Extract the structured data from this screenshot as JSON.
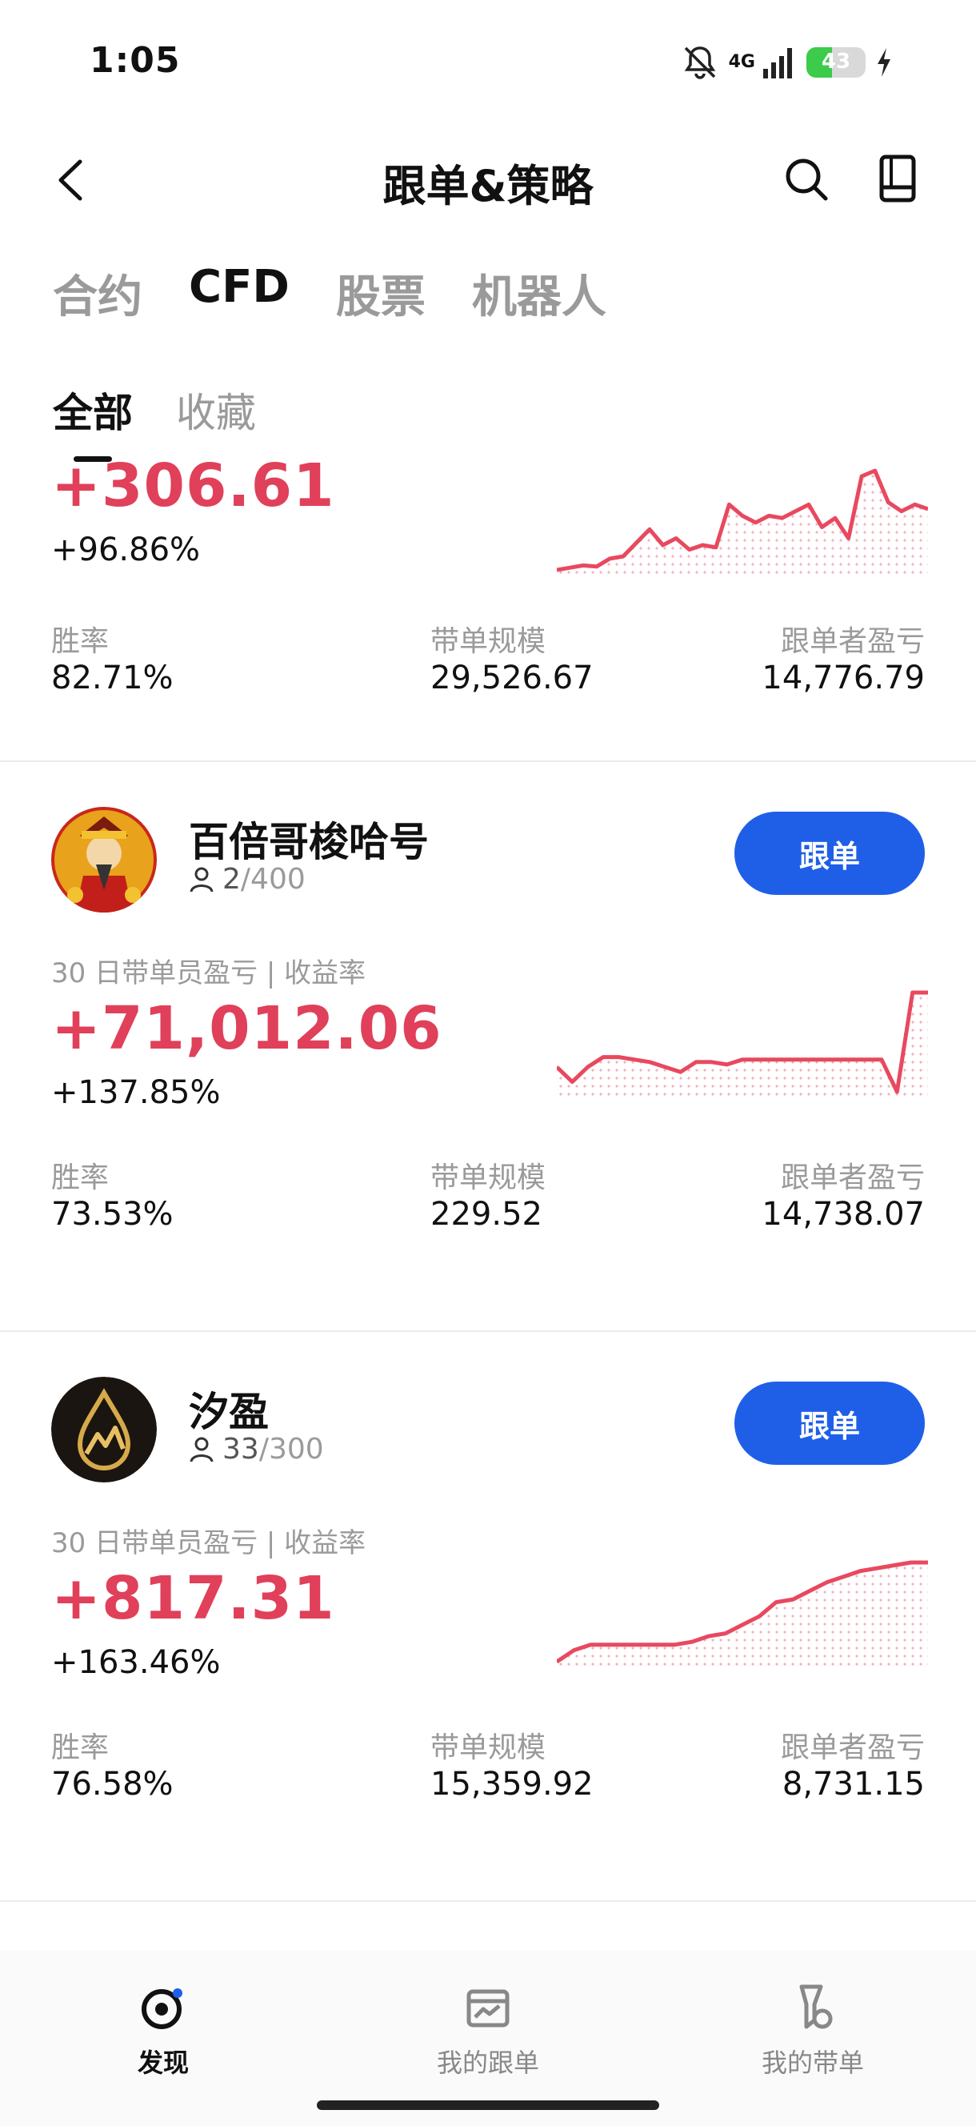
{
  "status_bar": {
    "time": "1:05",
    "network": "4G",
    "battery": "43",
    "battery_level": 0.43
  },
  "header": {
    "title": "跟单&策略"
  },
  "category_tabs": [
    {
      "label": "合约",
      "active": false
    },
    {
      "label": "CFD",
      "active": true
    },
    {
      "label": "股票",
      "active": false
    },
    {
      "label": "机器人",
      "active": false
    }
  ],
  "sub_tabs": [
    {
      "label": "全部",
      "active": true
    },
    {
      "label": "收藏",
      "active": false
    }
  ],
  "cards": [
    {
      "pnl": "+306.61",
      "return_pct": "+96.86%",
      "stats": {
        "win_rate_label": "胜率",
        "win_rate": "82.71%",
        "scale_label": "带单规模",
        "scale": "29,526.67",
        "follower_pnl_label": "跟单者盈亏",
        "follower_pnl": "14,776.79"
      },
      "spark": [
        12,
        14,
        16,
        15,
        22,
        24,
        36,
        48,
        34,
        40,
        30,
        34,
        32,
        70,
        60,
        54,
        60,
        58,
        64,
        70,
        50,
        58,
        40,
        95,
        100,
        72,
        64,
        70,
        66
      ]
    },
    {
      "name": "百倍哥梭哈号",
      "followers": "2",
      "capacity": "/400",
      "metric_label": "30 日带单员盈亏 | 收益率",
      "pnl": "+71,012.06",
      "return_pct": "+137.85%",
      "follow_label": "跟单",
      "stats": {
        "win_rate_label": "胜率",
        "win_rate": "73.53%",
        "scale_label": "带单规模",
        "scale": "229.52",
        "follower_pnl_label": "跟单者盈亏",
        "follower_pnl": "14,738.07"
      },
      "spark": [
        40,
        28,
        40,
        48,
        48,
        46,
        44,
        40,
        36,
        44,
        44,
        42,
        46,
        46,
        46,
        46,
        46,
        46,
        46,
        46,
        46,
        46,
        20,
        100,
        100
      ]
    },
    {
      "name": "汐盈",
      "followers": "33",
      "capacity": "/300",
      "metric_label": "30 日带单员盈亏 | 收益率",
      "pnl": "+817.31",
      "return_pct": "+163.46%",
      "follow_label": "跟单",
      "stats": {
        "win_rate_label": "胜率",
        "win_rate": "76.58%",
        "scale_label": "带单规模",
        "scale": "15,359.92",
        "follower_pnl_label": "跟单者盈亏",
        "follower_pnl": "8,731.15"
      },
      "spark": [
        8,
        16,
        20,
        20,
        20,
        20,
        20,
        20,
        22,
        26,
        28,
        34,
        40,
        50,
        52,
        58,
        64,
        68,
        72,
        74,
        76,
        78,
        78
      ]
    }
  ],
  "bottom_nav": [
    {
      "label": "发现",
      "icon": "discover-icon",
      "active": true
    },
    {
      "label": "我的跟单",
      "icon": "chart-card-icon",
      "active": false
    },
    {
      "label": "我的带单",
      "icon": "flask-medal-icon",
      "active": false
    }
  ],
  "colors": {
    "accent": "#1f5fe8",
    "profit": "#e0405a",
    "spark_line": "#e8495f"
  }
}
